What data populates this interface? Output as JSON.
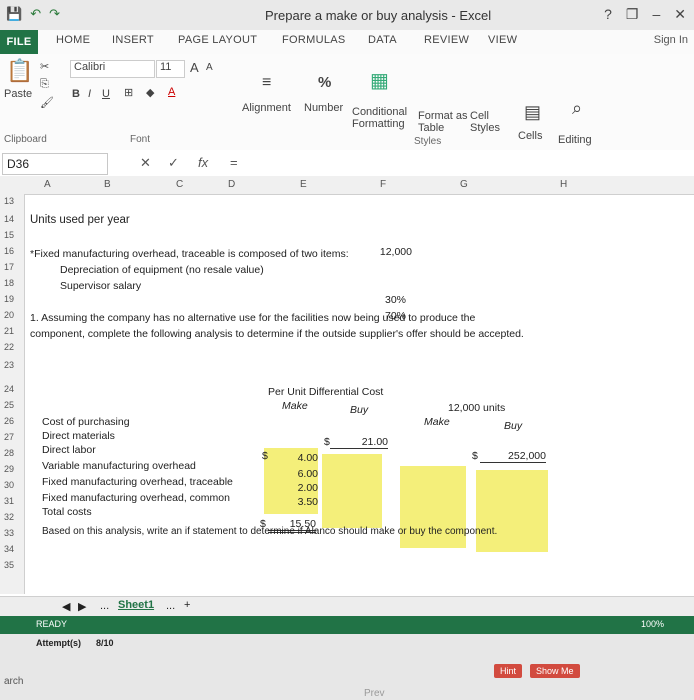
{
  "titlebar": {
    "title": "Prepare a make or buy analysis - Excel",
    "help": "?",
    "restore": "❐",
    "minimize": "–",
    "close": "✕"
  },
  "tabs": [
    "FILE",
    "HOME",
    "INSERT",
    "PAGE LAYOUT",
    "FORMULAS",
    "DATA",
    "REVIEW",
    "VIEW"
  ],
  "signin": "Sign In",
  "ribbon": {
    "paste": "Paste",
    "clipboard": "Clipboard",
    "font_name": "Calibri",
    "font_size": "11",
    "font_group": "Font",
    "bold": "B",
    "italic": "I",
    "underline": "U",
    "grow_font": "A",
    "shrink_font": "A",
    "alignment": "Alignment",
    "number": "Number",
    "percent": "%",
    "conditional_formatting_1": "Conditional",
    "conditional_formatting_2": "Formatting",
    "format_as_table_1": "Format as",
    "format_as_table_2": "Table",
    "cell_styles_1": "Cell",
    "cell_styles_2": "Styles",
    "styles_group": "Styles",
    "cells": "Cells",
    "editing": "Editing"
  },
  "formula_bar": {
    "name_box": "D36",
    "cancel": "✕",
    "enter": "✓",
    "fx": "fx",
    "equals": "="
  },
  "columns": [
    "A",
    "B",
    "C",
    "D",
    "E",
    "F",
    "G",
    "H"
  ],
  "rows": [
    "13",
    "14",
    "15",
    "16",
    "17",
    "18",
    "19",
    "20",
    "21",
    "22",
    "23",
    "24",
    "25",
    "26",
    "27",
    "28",
    "29",
    "30",
    "31",
    "32",
    "33",
    "34",
    "35"
  ],
  "content": {
    "units_label": "Units used per year",
    "units_value": "12,000",
    "overhead_note": "*Fixed manufacturing overhead, traceable is composed of two items:",
    "depreciation": "Depreciation of equipment (no resale value)",
    "depreciation_pct": "30%",
    "supervisor": "Supervisor salary",
    "supervisor_pct": "70%",
    "question_1a": "1. Assuming the company has no alternative use for the facilities now being used to produce the",
    "question_1b": "component, complete the following analysis to determine if the outside supplier's offer should be accepted.",
    "hdr_per_unit": "Per Unit Differential Cost",
    "hdr_make": "Make",
    "hdr_buy": "Buy",
    "hdr_12000": "12,000 units",
    "hdr_make2": "Make",
    "hdr_buy2": "Buy",
    "cost_purchasing": "Cost of purchasing",
    "buy_value_dollar": "$",
    "buy_value": "21.00",
    "buy_total_dollar": "$",
    "buy_total": "252,000",
    "direct_materials": "Direct materials",
    "direct_labor": "Direct labor",
    "variable_oh": "Variable manufacturing overhead",
    "fixed_traceable": "Fixed manufacturing overhead, traceable",
    "fixed_common": "Fixed manufacturing overhead, common",
    "total_costs": "Total costs",
    "dollar": "$",
    "make_values": [
      "4.00",
      "6.00",
      "2.00",
      "3.50"
    ],
    "total_dollar": "$",
    "total_make": "15.50",
    "based_on": "Based on this analysis, write an if statement to determine if Alanco should make or buy the component."
  },
  "sheetbar": {
    "tab": "Sheet1",
    "more": "...",
    "add": "+"
  },
  "status": {
    "ready": "READY",
    "attempts_label": "Attempt(s)",
    "attempts_value": "8/10",
    "zoom": "100%"
  },
  "hint_button": "Hint",
  "showme_button": "Show Me",
  "footer": {
    "left": "arch",
    "prev": "Prev"
  },
  "colors": {
    "excel_green": "#217346",
    "yellow_input": "#f4ef7a"
  }
}
